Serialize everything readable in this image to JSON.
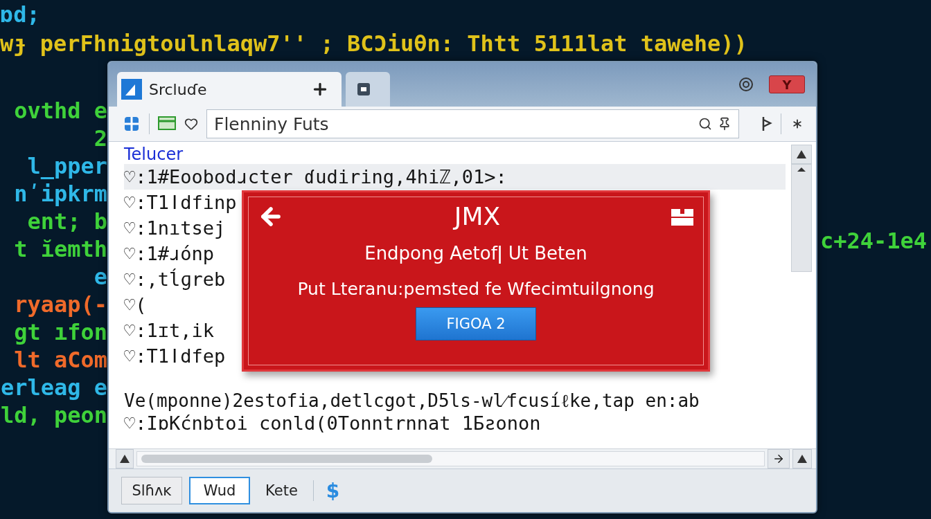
{
  "background_code": {
    "top_lines": [
      {
        "text": "ɒd;",
        "color": "#2fb8e8"
      },
      {
        "text": "wɟ perFhnigtoulnlaqw7'' ; ВCƆiuθn: Thtt 5111lat tawehe))",
        "color": "#e0c21a"
      }
    ],
    "left_lines": [
      {
        "text": "ovthd e",
        "color": "#3fd23a"
      },
      {
        "text": "2",
        "color": "#3fd23a"
      },
      {
        "text": "l_pper",
        "color": "#2fb8e8"
      },
      {
        "text": "nʹipkrm",
        "color": "#2fb8e8"
      },
      {
        "text": "ent; b",
        "color": "#3fd23a"
      },
      {
        "text": "t ĭemth",
        "color": "#3fd23a"
      },
      {
        "text": "e",
        "color": "#2fb8e8"
      },
      {
        "text": "ryaap(-",
        "color": "#f06a2a"
      },
      {
        "text": "gt ıfon",
        "color": "#3fd23a"
      },
      {
        "text": "lt aCom",
        "color": "#f06a2a"
      },
      {
        "text": "erleag e",
        "color": "#2fb8e8"
      },
      {
        "text": "ld, peon",
        "color": "#3fd23a"
      }
    ],
    "right_lines": [
      {
        "text": "c+24-1e4",
        "color": "#3fd23a"
      }
    ]
  },
  "window": {
    "tabs": [
      {
        "kind": "text",
        "label": "Srcluɗe",
        "selected": true
      },
      {
        "kind": "icon",
        "selected": false
      }
    ],
    "address_bar": {
      "value": "Flenniny Futs"
    },
    "content": {
      "header": "Telucer",
      "rows": [
        {
          "text": "♡:1#Eoobodɹcter ɗudiring,4hiℤ,01>:",
          "selected": true
        },
        {
          "text": "♡:T1ǀdfinp",
          "selected": false
        },
        {
          "text": "♡:1nıtsej",
          "selected": false
        },
        {
          "text": "♡:1#ɹónp",
          "selected": false
        },
        {
          "text": "♡:,tĺɡreb",
          "selected": false
        },
        {
          "text": "♡(",
          "selected": false
        },
        {
          "text": "♡:1ɪt,ik",
          "selected": false
        },
        {
          "text": "♡:T1ǀdfep",
          "selected": false
        }
      ],
      "footer_line": "Ve(mponne)2estofia,detlcgot,D5ls-wl⁄fcusíℓke,tap en:ab",
      "last_line": "♡:IɒKćnbtoi conld(0Tonntrnnat 1Ƃƨonon"
    },
    "dialog": {
      "title": "JMX",
      "heading": "Endpong Aetofǀ Ut Beten",
      "message": "Put Lteranu:pemsted fe Wfecimtuilgnong",
      "button": "FIGOA 2"
    },
    "bottom_buttons": [
      {
        "label": "Slɦʌĸ",
        "selected": false
      },
      {
        "label": "Wud",
        "selected": true
      },
      {
        "label": "Kete",
        "selected": false
      }
    ],
    "currency_symbol": "$",
    "close_label": "Y"
  }
}
